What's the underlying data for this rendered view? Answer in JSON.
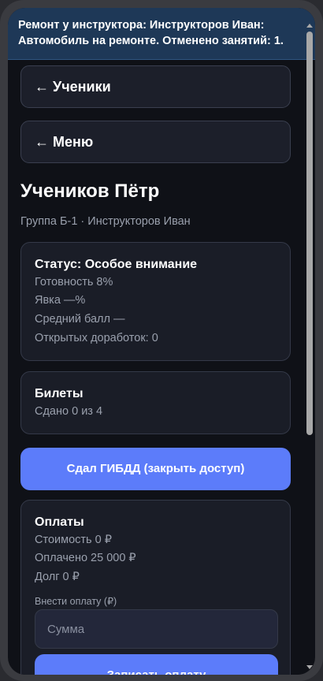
{
  "banner": {
    "line1": "Ремонт у инструктора: Инструкторов Иван:",
    "line2": "Автомобиль на ремонте. Отменено занятий: 1."
  },
  "nav": {
    "students_label": "← Ученики",
    "menu_label": "← Меню"
  },
  "student": {
    "name": "Учеников Пётр",
    "subtitle": "Группа Б-1 · Инструкторов Иван"
  },
  "status_card": {
    "title": "Статус: Особое внимание",
    "readiness": "Готовность 8%",
    "attendance": "Явка —%",
    "avg_score": "Средний балл —",
    "open_tasks": "Открытых доработок: 0"
  },
  "tickets_card": {
    "title": "Билеты",
    "progress": "Сдано 0 из 4"
  },
  "exam_button": {
    "label": "Сдал ГИБДД (закрыть доступ)"
  },
  "payments_card": {
    "title": "Оплаты",
    "cost": "Стоимость 0 ₽",
    "paid": "Оплачено 25 000 ₽",
    "debt": "Долг 0 ₽",
    "amount_label": "Внести оплату (₽)",
    "amount_placeholder": "Сумма",
    "amount_value": "",
    "submit_label": "Записать оплату"
  },
  "colors": {
    "background": "#0f1117",
    "card": "#1a1d27",
    "banner": "#1e3857",
    "accent": "#5c7cfa",
    "muted_text": "#9aa0ad"
  }
}
